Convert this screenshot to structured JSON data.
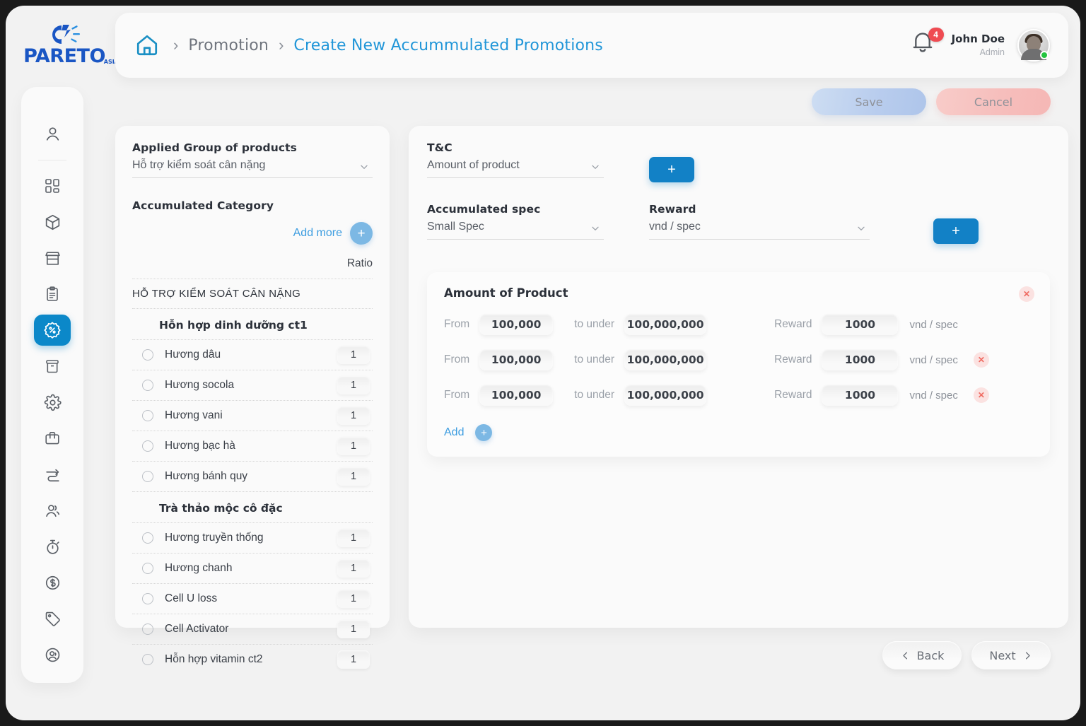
{
  "brand": {
    "name": "PARETO",
    "suffix": "ASIA"
  },
  "breadcrumb": {
    "home_icon": "home-icon",
    "separator": "›",
    "items": [
      {
        "label": "Promotion",
        "active": false
      },
      {
        "label": "Create New Accummulated Promotions",
        "active": true
      }
    ]
  },
  "header": {
    "notification_count": "4",
    "user_name": "John Doe",
    "user_role": "Admin"
  },
  "actions": {
    "save_label": "Save",
    "cancel_label": "Cancel"
  },
  "sidebar": {
    "items": [
      {
        "icon": "user-icon",
        "active": false
      },
      {
        "icon": "dashboard-grid-icon",
        "active": false
      },
      {
        "icon": "box-cube-icon",
        "active": false
      },
      {
        "icon": "store-icon",
        "active": false
      },
      {
        "icon": "clipboard-icon",
        "active": false
      },
      {
        "icon": "promotion-discount-icon",
        "active": true
      },
      {
        "icon": "archive-box-icon",
        "active": false
      },
      {
        "icon": "gear-icon",
        "active": false
      },
      {
        "icon": "briefcase-icon",
        "active": false
      },
      {
        "icon": "transfer-arrows-icon",
        "active": false
      },
      {
        "icon": "users-group-icon",
        "active": false
      },
      {
        "icon": "stopwatch-icon",
        "active": false
      },
      {
        "icon": "dollar-circle-icon",
        "active": false
      },
      {
        "icon": "tag-icon",
        "active": false
      },
      {
        "icon": "account-circle-icon",
        "active": false
      }
    ]
  },
  "left_panel": {
    "applied_group_label": "Applied Group of products",
    "applied_group_value": "Hỗ trợ kiểm soát cân nặng",
    "accumulated_category_label": "Accumulated Category",
    "add_more_label": "Add more",
    "add_more_icon": "plus-icon",
    "ratio_header": "Ratio",
    "group_name": "HỖ TRỢ KIỂM SOÁT CÂN NẶNG",
    "sections": [
      {
        "title": "Hỗn hợp dinh dưỡng ct1",
        "products": [
          {
            "name": "Hương dâu",
            "ratio": "1"
          },
          {
            "name": " Hương socola",
            "ratio": "1"
          },
          {
            "name": "Hương vani",
            "ratio": "1"
          },
          {
            "name": "Hương bạc hà",
            "ratio": "1"
          },
          {
            "name": "Hương bánh quy",
            "ratio": "1"
          }
        ]
      },
      {
        "title": "Trà thảo mộc cô đặc",
        "products": [
          {
            "name": "Hương truyền thống",
            "ratio": "1"
          },
          {
            "name": "Hương chanh",
            "ratio": "1"
          },
          {
            "name": "Cell U loss",
            "ratio": "1"
          },
          {
            "name": "Cell Activator",
            "ratio": "1"
          },
          {
            "name": "Hỗn hợp vitamin ct2",
            "ratio": "1"
          }
        ]
      }
    ]
  },
  "right_panel": {
    "tc_label": "T&C",
    "tc_value": "Amount of product",
    "tc_add_icon": "plus-icon",
    "spec_label": "Accumulated spec",
    "spec_value": "Small Spec",
    "reward_label": "Reward",
    "reward_value": "vnd / spec",
    "spec_add_icon": "plus-icon",
    "inner_card": {
      "title": "Amount of Product",
      "close_icon": "close-x-icon",
      "from_label": "From",
      "to_label": "to under",
      "reward_label": "Reward",
      "unit": "vnd / spec",
      "tiers": [
        {
          "from": "100,000",
          "to": "100,000,000",
          "reward": "1000",
          "removable": false
        },
        {
          "from": "100,000",
          "to": "100,000,000",
          "reward": "1000",
          "removable": true
        },
        {
          "from": "100,000",
          "to": "100,000,000",
          "reward": "1000",
          "removable": true
        }
      ],
      "add_label": "Add",
      "add_icon": "plus-icon"
    }
  },
  "footer": {
    "back_label": "Back",
    "next_label": "Next",
    "back_icon": "chevron-left-icon",
    "next_icon": "chevron-right-icon"
  },
  "colors": {
    "accent_blue": "#1281c6",
    "link_blue": "#3d9de0",
    "title_blue": "#2196d8",
    "danger_red": "#ef6b62",
    "badge_red": "#ef4b52",
    "brand_blue": "#1a56c4"
  }
}
